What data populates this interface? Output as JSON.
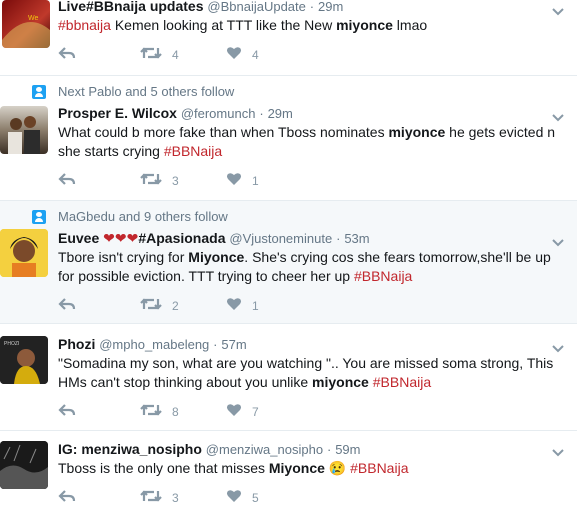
{
  "tweets": [
    {
      "name": "Live#BBnaija updates",
      "handle": "@BbnaijaUpdate",
      "sep": "·",
      "time": "29m",
      "text_parts": [
        {
          "t": "#bbnaija",
          "k": "tag"
        },
        {
          "t": " Kemen looking at TTT like the New ",
          "k": "plain"
        },
        {
          "t": "miyonce",
          "k": "bold"
        },
        {
          "t": " lmao",
          "k": "plain"
        }
      ],
      "retweets": "4",
      "likes": "4"
    },
    {
      "context": "Next Pablo and 5 others follow",
      "name": "Prosper E. Wilcox",
      "handle": "@feromunch",
      "sep": "·",
      "time": "29m",
      "text_parts": [
        {
          "t": "What  could b more fake than when Tboss nominates ",
          "k": "plain"
        },
        {
          "t": "miyonce",
          "k": "bold"
        },
        {
          "t": " he gets evicted n she starts crying ",
          "k": "plain"
        },
        {
          "t": "#BBNaija",
          "k": "tag"
        }
      ],
      "retweets": "3",
      "likes": "1"
    },
    {
      "context": "MaGbedu and 9 others follow",
      "name": "Euvee",
      "name_suffix": "#Apasionada",
      "handle": "@Vjustoneminute",
      "sep": "·",
      "time": "53m",
      "text_parts": [
        {
          "t": "Tbore isn't crying for ",
          "k": "plain"
        },
        {
          "t": "Miyonce",
          "k": "bold"
        },
        {
          "t": ". She's crying cos she fears tomorrow,she'll be up for possible eviction. TTT trying to cheer her up ",
          "k": "plain"
        },
        {
          "t": "#BBNaija",
          "k": "tag"
        }
      ],
      "retweets": "2",
      "likes": "1"
    },
    {
      "name": "Phozi",
      "handle": "@mpho_mabeleng",
      "sep": "·",
      "time": "57m",
      "text_parts": [
        {
          "t": "\"Somadina my son, what are you watching \".. You are missed soma strong, This HMs can't stop thinking about you unlike ",
          "k": "plain"
        },
        {
          "t": "miyonce",
          "k": "bold"
        },
        {
          "t": " ",
          "k": "plain"
        },
        {
          "t": "#BBNaija",
          "k": "tag"
        }
      ],
      "retweets": "8",
      "likes": "7"
    },
    {
      "name": "IG: menziwa_nosipho",
      "handle": "@menziwa_nosipho",
      "sep": "·",
      "time": "59m",
      "text_parts": [
        {
          "t": "Tboss is the only one that misses ",
          "k": "plain"
        },
        {
          "t": "Miyonce",
          "k": "bold"
        },
        {
          "t": " ",
          "k": "plain"
        },
        {
          "t": "😢",
          "k": "plain"
        },
        {
          "t": " ",
          "k": "plain"
        },
        {
          "t": "#BBNaija",
          "k": "tag"
        }
      ],
      "retweets": "3",
      "likes": "5"
    }
  ],
  "icons": {
    "reply": "reply-icon",
    "retweet": "retweet-icon",
    "like": "heart-icon",
    "caret": "chevron-down-icon",
    "context": "follow-person-icon"
  },
  "colors": {
    "hashtag": "#c1272d",
    "meta": "#657786",
    "action": "#8899a6",
    "highlight_bg": "#f5f8fa",
    "follow_icon": "#1da1f2"
  }
}
